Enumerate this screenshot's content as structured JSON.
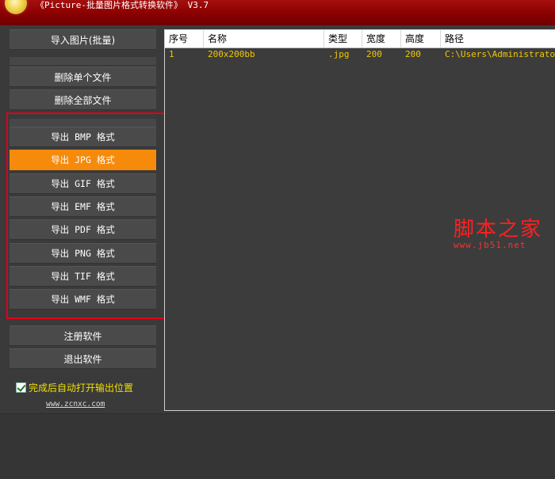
{
  "window": {
    "title": "《Picture-批量图片格式转换软件》 V3.7",
    "logo_icon": "sun-logo-icon"
  },
  "left": {
    "import_label": "导入图片(批量)",
    "delete_single_label": "删除单个文件",
    "delete_all_label": "删除全部文件",
    "export_buttons": [
      {
        "label": "导出 BMP 格式"
      },
      {
        "label": "导出 JPG 格式"
      },
      {
        "label": "导出 GIF 格式"
      },
      {
        "label": "导出 EMF 格式"
      },
      {
        "label": "导出 PDF 格式"
      },
      {
        "label": "导出 PNG 格式"
      },
      {
        "label": "导出 TIF 格式"
      },
      {
        "label": "导出 WMF 格式"
      }
    ],
    "active_export": "导出 JPG 格式",
    "register_label": "注册软件",
    "exit_label": "退出软件",
    "auto_open_label": "完成后自动打开输出位置",
    "auto_open_checked": true,
    "website": "www.zcnxc.com"
  },
  "table": {
    "headers": [
      "序号",
      "名称",
      "类型",
      "宽度",
      "高度",
      "路径"
    ],
    "rows": [
      [
        "1",
        "200x200bb",
        ".jpg",
        "200",
        "200",
        "C:\\Users\\Administrator\\F"
      ]
    ]
  },
  "watermark": {
    "cn": "脚本之家",
    "url": "www.jb51.net"
  },
  "colors": {
    "title_bar": "#8b0000",
    "active_button": "#f58a0b",
    "highlight_box": "#e1001a",
    "row_text": "#f2c800",
    "check_label": "#f0e000"
  }
}
